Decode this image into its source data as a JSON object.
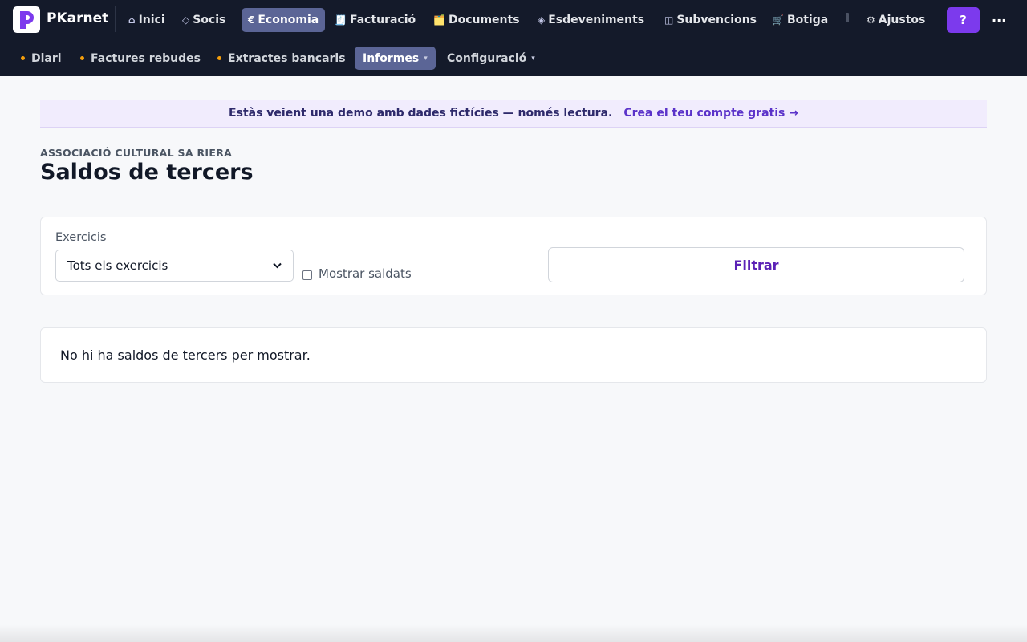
{
  "app": {
    "name": "PKarnet"
  },
  "topnav": {
    "items": [
      {
        "icon": "home-icon",
        "glyph": "⌂",
        "label": "Inici"
      },
      {
        "icon": "diamond-icon",
        "glyph": "◇",
        "label": "Socis"
      },
      {
        "icon": "euro-icon",
        "glyph": "€",
        "label": "Economia",
        "active": true
      },
      {
        "icon": "receipt-icon",
        "glyph": "🧾",
        "label": "Facturació"
      },
      {
        "icon": "folder-icon",
        "glyph": "🗂️",
        "label": "Documents"
      },
      {
        "icon": "event-icon",
        "glyph": "◈",
        "label": "Esdeveniments"
      },
      {
        "icon": "grant-icon",
        "glyph": "◫",
        "label": "Subvencions"
      },
      {
        "icon": "cart-icon",
        "glyph": "🛒",
        "label": "Botiga"
      }
    ],
    "settings": {
      "icon": "gear-icon",
      "glyph": "⚙",
      "label": "Ajustos"
    },
    "help": "?",
    "more": "..."
  },
  "subnav": {
    "items": [
      {
        "label": "Diari",
        "dot": true
      },
      {
        "label": "Factures rebudes",
        "dot": true
      },
      {
        "label": "Extractes bancaris",
        "dot": true
      },
      {
        "label": "Informes",
        "dropdown": true,
        "active": true
      },
      {
        "label": "Configuració",
        "dropdown": true
      }
    ],
    "caret": "▾"
  },
  "banner": {
    "message": "Estàs veient una demo amb dades fictícies — només lectura.",
    "cta": "Crea el teu compte gratis →"
  },
  "page": {
    "org": "ASSOCIACIÓ CULTURAL SA RIERA",
    "title": "Saldos de tercers"
  },
  "filters": {
    "year_label": "Exercicis",
    "year_value": "Tots els exercicis",
    "show_settled_label": "Mostrar saldats",
    "show_settled_checked": false,
    "submit": "Filtrar"
  },
  "results": {
    "empty_message": "No hi ha saldos de tercers per mostrar."
  },
  "colors": {
    "navbar_bg": "#141a2a",
    "active_nav_bg": "#5b6596",
    "accent": "#7c3aed",
    "dot": "#f59e0b",
    "banner_bg": "#f1ecfd"
  }
}
